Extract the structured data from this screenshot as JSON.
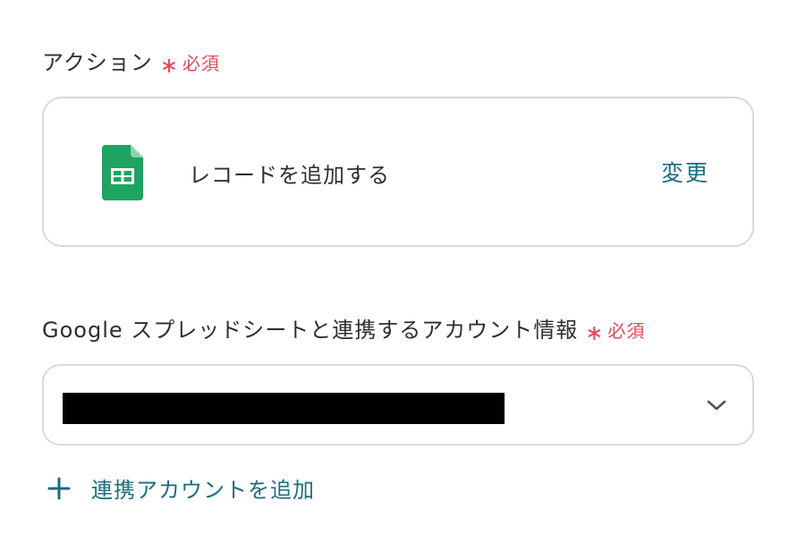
{
  "action_field": {
    "label": "アクション",
    "required_mark": "∗",
    "required_text": "必須"
  },
  "action_card": {
    "icon": "google-sheets-icon",
    "action_name": "レコードを追加する",
    "change_label": "変更"
  },
  "account_field": {
    "label": "Google スプレッドシートと連携するアカウント情報",
    "required_mark": "∗",
    "required_text": "必須",
    "selected_value_redacted": true,
    "dropdown_icon": "chevron-down-icon"
  },
  "add_account": {
    "icon": "plus-icon",
    "label": "連携アカウントを追加"
  },
  "colors": {
    "required": "#e8465a",
    "link": "#1a6c80",
    "border": "#d9d9d9",
    "sheets_green": "#1ea362"
  }
}
